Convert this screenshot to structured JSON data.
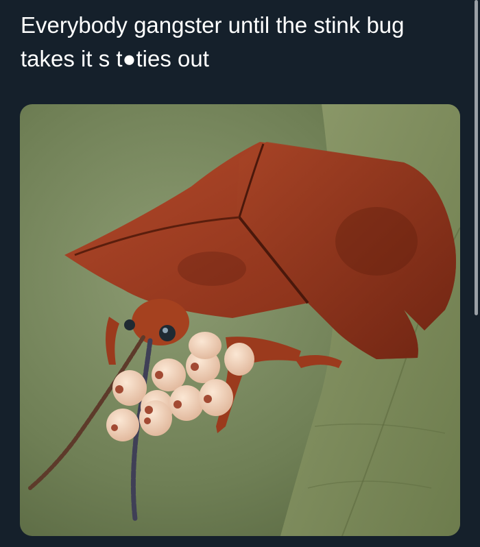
{
  "tweet": {
    "text_line1": "Everybody gangster until the stink bug",
    "text_line2": "takes it s t●ties out"
  },
  "media": {
    "subject": "Tortoise beetle photographed on a leaf"
  },
  "colors": {
    "background": "#15202b",
    "text": "#ffffff",
    "leaf": "#7d8f63",
    "shell": "#9a3a1f"
  }
}
